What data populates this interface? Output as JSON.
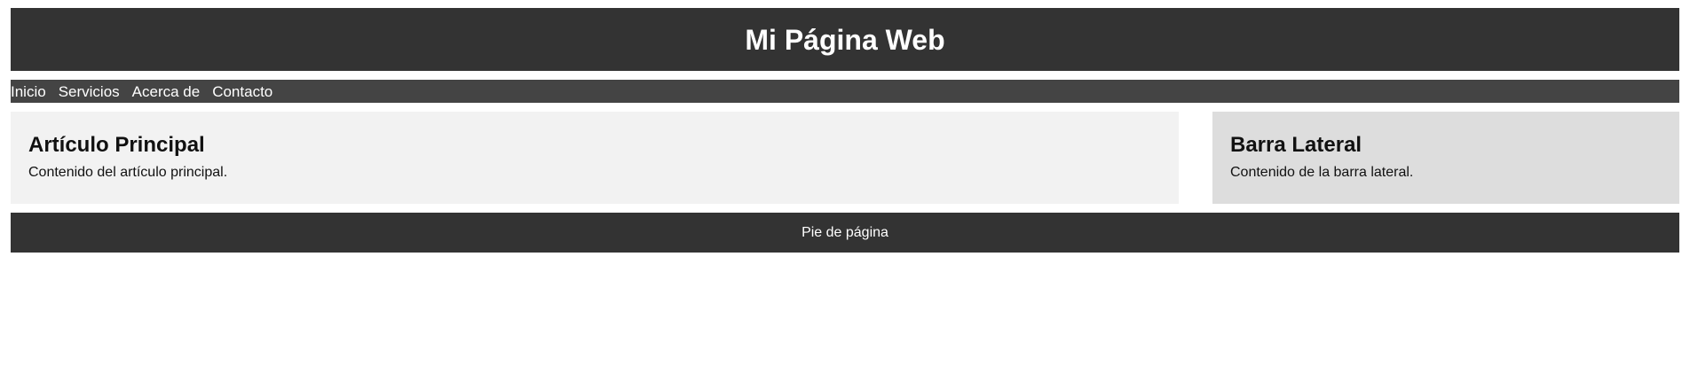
{
  "header": {
    "title": "Mi Página Web"
  },
  "nav": {
    "items": [
      {
        "label": "Inicio"
      },
      {
        "label": "Servicios"
      },
      {
        "label": "Acerca de"
      },
      {
        "label": "Contacto"
      }
    ]
  },
  "main": {
    "article": {
      "title": "Artículo Principal",
      "body": "Contenido del artículo principal."
    },
    "sidebar": {
      "title": "Barra Lateral",
      "body": "Contenido de la barra lateral."
    }
  },
  "footer": {
    "text": "Pie de página"
  },
  "colors": {
    "header_bg": "#333333",
    "nav_bg": "#444444",
    "article_bg": "#f2f2f2",
    "sidebar_bg": "#dddddd",
    "footer_bg": "#333333"
  }
}
